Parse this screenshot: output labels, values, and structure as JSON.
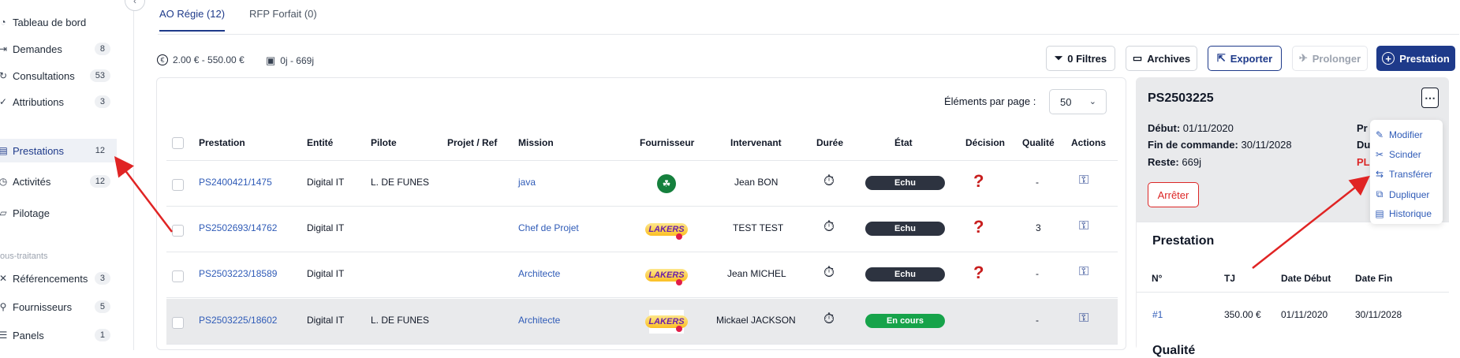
{
  "sidebar": {
    "items": [
      {
        "name": "tableau",
        "icon": "dashboard-icon",
        "label": "Tableau de bord",
        "badge": null
      },
      {
        "name": "demandes",
        "icon": "enter-icon",
        "label": "Demandes",
        "badge": "8"
      },
      {
        "name": "consultations",
        "icon": "refresh-icon",
        "label": "Consultations",
        "badge": "53"
      },
      {
        "name": "attributions",
        "icon": "check-icon",
        "label": "Attributions",
        "badge": "3"
      },
      {
        "name": "prestations",
        "icon": "document-icon",
        "label": "Prestations",
        "badge": "12"
      },
      {
        "name": "activites",
        "icon": "activity-icon",
        "label": "Activités",
        "badge": "12"
      },
      {
        "name": "pilotage",
        "icon": "pilotage-icon",
        "label": "Pilotage",
        "badge": null
      },
      {
        "name": "referencements",
        "icon": "cross-icon",
        "label": "Référencements",
        "badge": "3"
      },
      {
        "name": "fournisseurs",
        "icon": "supplier-icon",
        "label": "Fournisseurs",
        "badge": "5"
      },
      {
        "name": "panels",
        "icon": "list-icon",
        "label": "Panels",
        "badge": "1"
      }
    ],
    "section_label": "ous-traitants"
  },
  "tabs": [
    "AO Régie (12)",
    "RFP Forfait (0)"
  ],
  "filters": {
    "price_range": "2.00 € - 550.00 €",
    "duration_range": "0j - 669j"
  },
  "toolbar": {
    "filters_label": "0 Filtres",
    "archives_label": "Archives",
    "export_label": "Exporter",
    "extend_label": "Prolonger",
    "prestation_label": "Prestation"
  },
  "table": {
    "per_page_label": "Éléments par page :",
    "per_page_value": "50",
    "headers": [
      "Prestation",
      "Entité",
      "Pilote",
      "Projet / Ref",
      "Mission",
      "Fournisseur",
      "Intervenant",
      "Durée",
      "État",
      "Décision",
      "Qualité",
      "Actions"
    ],
    "rows": [
      {
        "prestation": "PS2400421/1475",
        "entite": "Digital IT",
        "pilote": "L. DE FUNES",
        "projet": "",
        "mission": "java",
        "fournisseur": "celtics",
        "intervenant": "Jean BON",
        "etat": "Echu",
        "etat_color": "#2d3340",
        "decision": "?",
        "qualite": "-"
      },
      {
        "prestation": "PS2502693/14762",
        "entite": "Digital IT",
        "pilote": "",
        "projet": "",
        "mission": "Chef de Projet",
        "fournisseur": "lakers",
        "intervenant": "TEST TEST",
        "etat": "Echu",
        "etat_color": "#2d3340",
        "decision": "?",
        "qualite": "3"
      },
      {
        "prestation": "PS2503223/18589",
        "entite": "Digital IT",
        "pilote": "",
        "projet": "",
        "mission": "Architecte",
        "fournisseur": "lakers",
        "intervenant": "Jean MICHEL",
        "etat": "Echu",
        "etat_color": "#2d3340",
        "decision": "?",
        "qualite": "-"
      },
      {
        "prestation": "PS2503225/18602",
        "entite": "Digital IT",
        "pilote": "L. DE FUNES",
        "projet": "",
        "mission": "Architecte",
        "fournisseur": "lakers",
        "intervenant": "Mickael JACKSON",
        "etat": "En cours",
        "etat_color": "#16a34a",
        "decision": "",
        "qualite": "-"
      }
    ]
  },
  "detail": {
    "title": "PS2503225",
    "debut_label": "Début:",
    "debut_value": "01/11/2020",
    "fin_label": "Fin de commande:",
    "fin_value": "30/11/2028",
    "reste_label": "Reste:",
    "reste_value": "669j",
    "right_top": "Pr",
    "right_mid": "Du",
    "right_bot": "PL",
    "stop_label": "Arrêter",
    "menu": [
      "Modifier",
      "Scinder",
      "Transférer",
      "Dupliquer",
      "Historique"
    ],
    "section_title": "Prestation",
    "sub_headers": [
      "N°",
      "TJ",
      "Date Début",
      "Date Fin"
    ],
    "sub_row": [
      "#1",
      "350.00 €",
      "01/11/2020",
      "30/11/2028"
    ],
    "next_section": "Qualité"
  },
  "colors": {
    "accent": "#1e3a8a",
    "link": "#2f5bb7",
    "danger": "#dc2626",
    "arrow": "#e02424"
  }
}
